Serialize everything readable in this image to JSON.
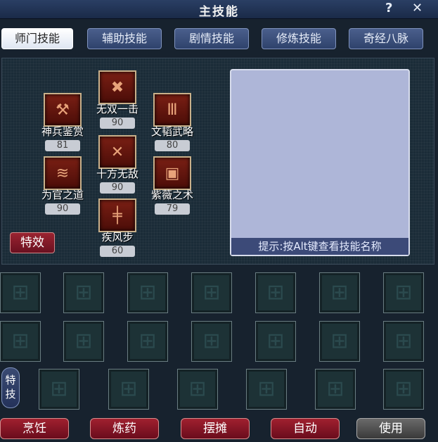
{
  "window": {
    "title": "主技能",
    "help": "?",
    "close": "✕"
  },
  "tabs": [
    {
      "label": "师门技能"
    },
    {
      "label": "辅助技能"
    },
    {
      "label": "剧情技能"
    },
    {
      "label": "修炼技能"
    },
    {
      "label": "奇经八脉"
    }
  ],
  "skills": [
    {
      "name": "无双一击",
      "level": "90"
    },
    {
      "name": "神兵鉴赏",
      "level": "81"
    },
    {
      "name": "文韬武略",
      "level": "80"
    },
    {
      "name": "十方无敌",
      "level": "90"
    },
    {
      "name": "为官之道",
      "level": "90"
    },
    {
      "name": "紫薇之术",
      "level": "79"
    },
    {
      "name": "疾风步",
      "level": "60"
    }
  ],
  "effect_button": "特效",
  "hint": "提示:按Alt键查看技能名称",
  "special_label_line1": "特",
  "special_label_line2": "技",
  "bottom_buttons": [
    {
      "label": "烹饪"
    },
    {
      "label": "炼药"
    },
    {
      "label": "摆摊"
    },
    {
      "label": "自动"
    },
    {
      "label": "使用"
    }
  ]
}
